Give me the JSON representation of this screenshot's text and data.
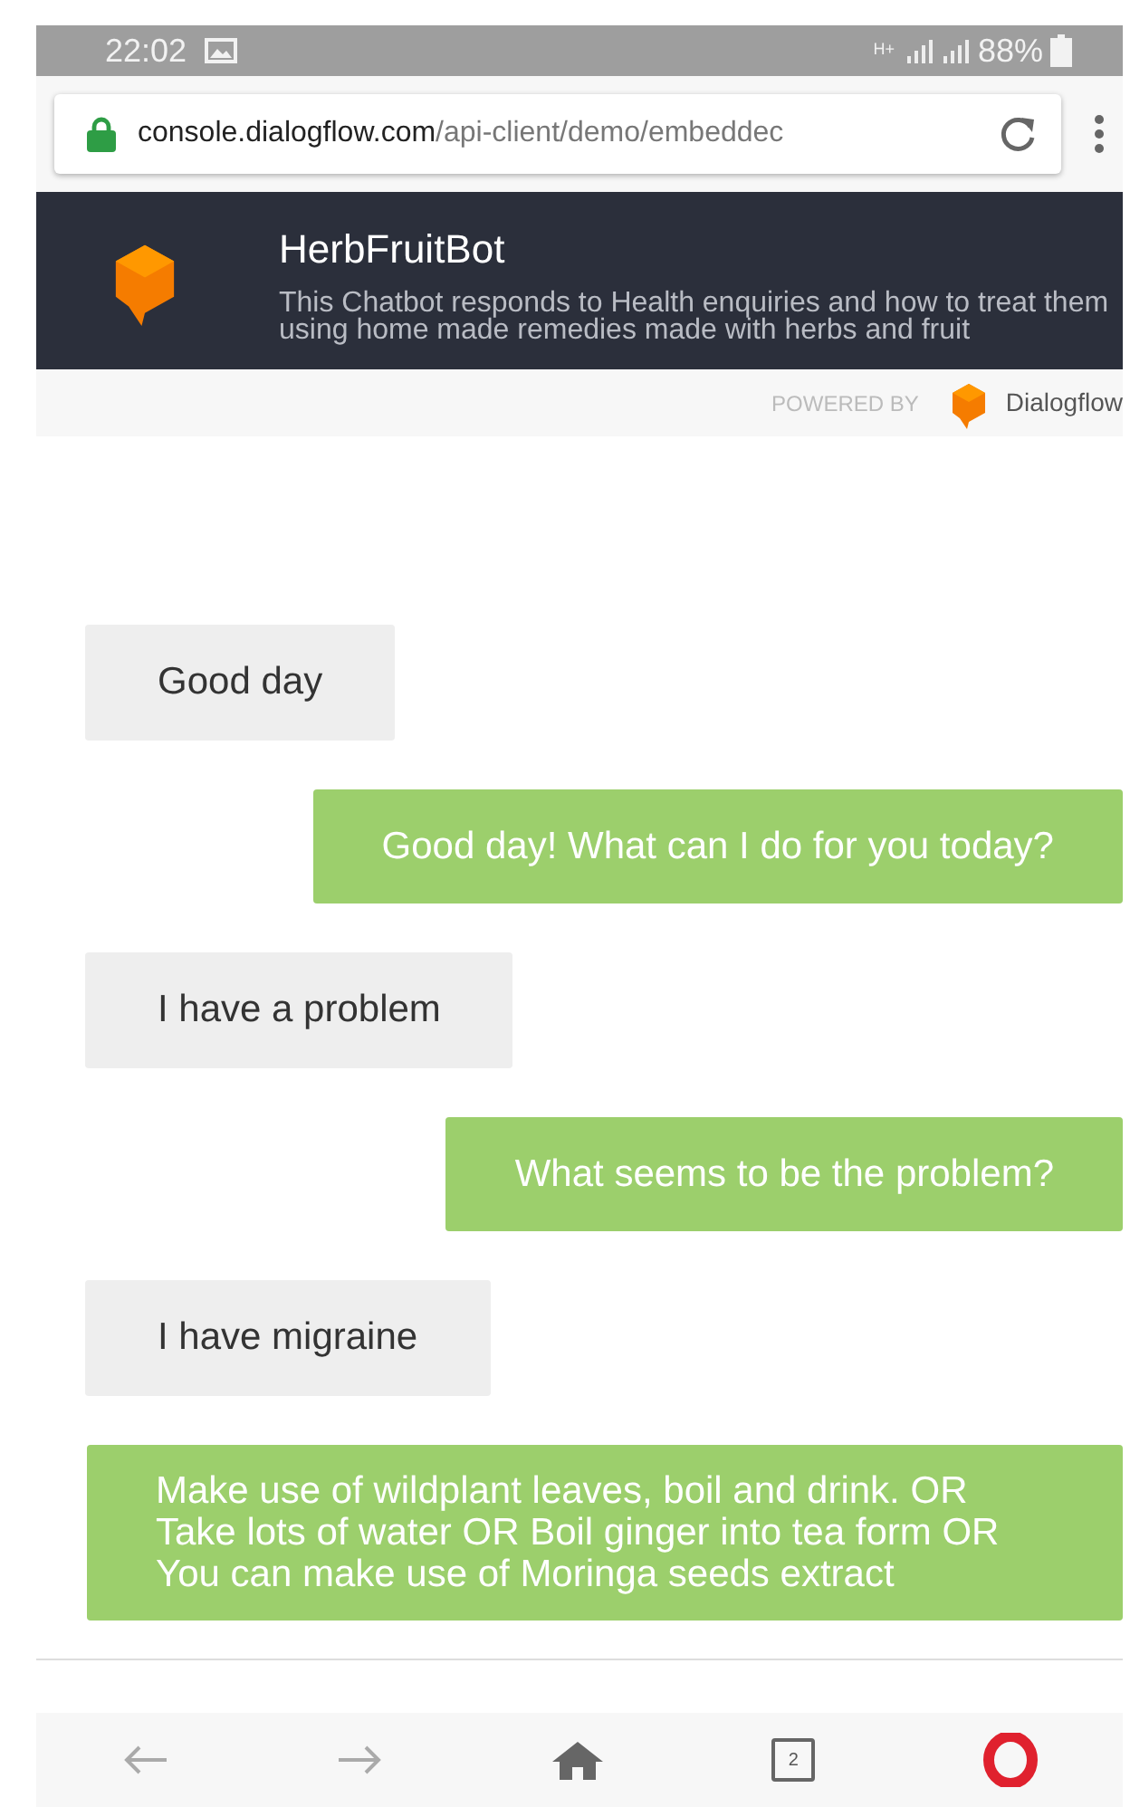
{
  "status_bar": {
    "time": "22:02",
    "network": "H+",
    "battery": "88%"
  },
  "address_bar": {
    "domain": "console.dialogflow.com",
    "path": "/api-client/demo/embeddec"
  },
  "header": {
    "title": "HerbFruitBot",
    "description": "This Chatbot responds to Health enquiries and how to treat them using home made remedies made with herbs and fruit"
  },
  "powered_by": {
    "label": "POWERED BY",
    "brand": "Dialogflow"
  },
  "messages": [
    {
      "kind": "user",
      "text": "Good day"
    },
    {
      "kind": "bot",
      "text": "Good day! What can I do for you today?"
    },
    {
      "kind": "user",
      "text": "I have a problem"
    },
    {
      "kind": "bot",
      "text": "What seems to be the problem?"
    },
    {
      "kind": "user",
      "text": "I have migraine"
    },
    {
      "kind": "bot",
      "text": "Make use of wildplant leaves, boil and drink. OR Take lots of water OR Boil ginger into tea form OR You can make use of Moringa seeds extract"
    }
  ],
  "bottom_nav": {
    "tab_count": "2"
  }
}
